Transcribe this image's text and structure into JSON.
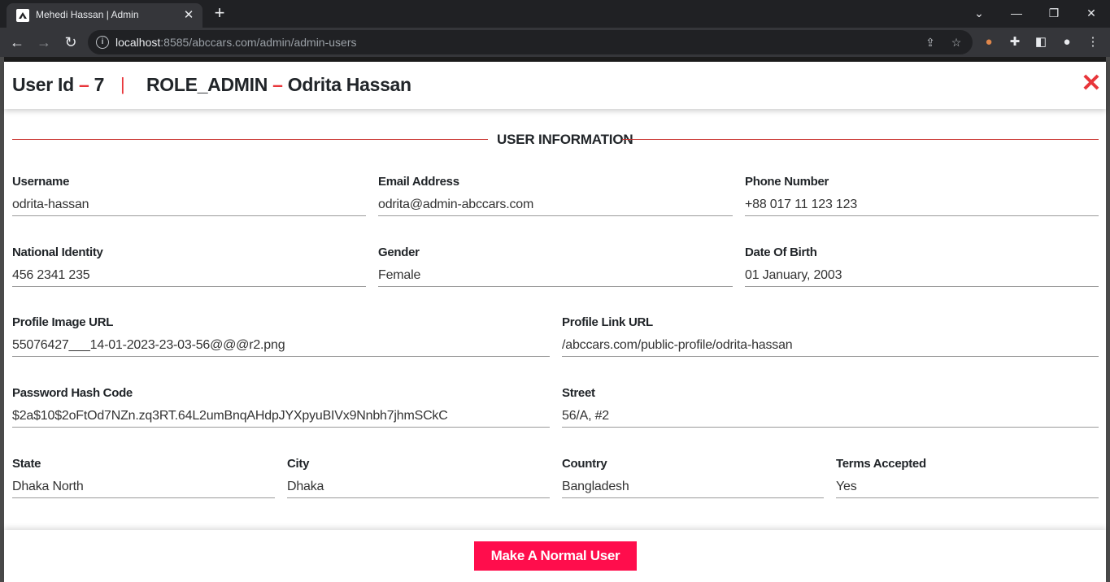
{
  "browser": {
    "tab_title": "Mehedi Hassan | Admin",
    "url_host": "localhost",
    "url_rest": ":8585/abccars.com/admin/admin-users"
  },
  "modal": {
    "user_id_label": "User Id",
    "user_id_dash": "–",
    "user_id": "7",
    "separator": "|",
    "role": "ROLE_ADMIN",
    "name_dash": "–",
    "name": "Odrita Hassan",
    "section_title": "USER INFORMATION",
    "fields": {
      "username": {
        "label": "Username",
        "value": "odrita-hassan"
      },
      "email": {
        "label": "Email Address",
        "value": "odrita@admin-abccars.com"
      },
      "phone": {
        "label": "Phone Number",
        "value": "+88 017 11 123 123"
      },
      "nid": {
        "label": "National Identity",
        "value": "456 2341 235"
      },
      "gender": {
        "label": "Gender",
        "value": "Female"
      },
      "dob": {
        "label": "Date Of Birth",
        "value": "01 January, 2003"
      },
      "profile_image": {
        "label": "Profile Image URL",
        "value": "55076427___14-01-2023-23-03-56@@@r2.png"
      },
      "profile_link": {
        "label": "Profile Link URL",
        "value": "/abccars.com/public-profile/odrita-hassan"
      },
      "password_hash": {
        "label": "Password Hash Code",
        "value": "$2a$10$2oFtOd7NZn.zq3RT.64L2umBnqAHdpJYXpyuBIVx9Nnbh7jhmSCkC"
      },
      "street": {
        "label": "Street",
        "value": "56/A, #2"
      },
      "state": {
        "label": "State",
        "value": "Dhaka North"
      },
      "city": {
        "label": "City",
        "value": "Dhaka"
      },
      "country": {
        "label": "Country",
        "value": "Bangladesh"
      },
      "terms": {
        "label": "Terms Accepted",
        "value": "Yes"
      }
    },
    "footer_button": "Make A Normal User"
  },
  "colors": {
    "accent_red": "#e8353a",
    "button_pink": "#ff0d4c"
  }
}
